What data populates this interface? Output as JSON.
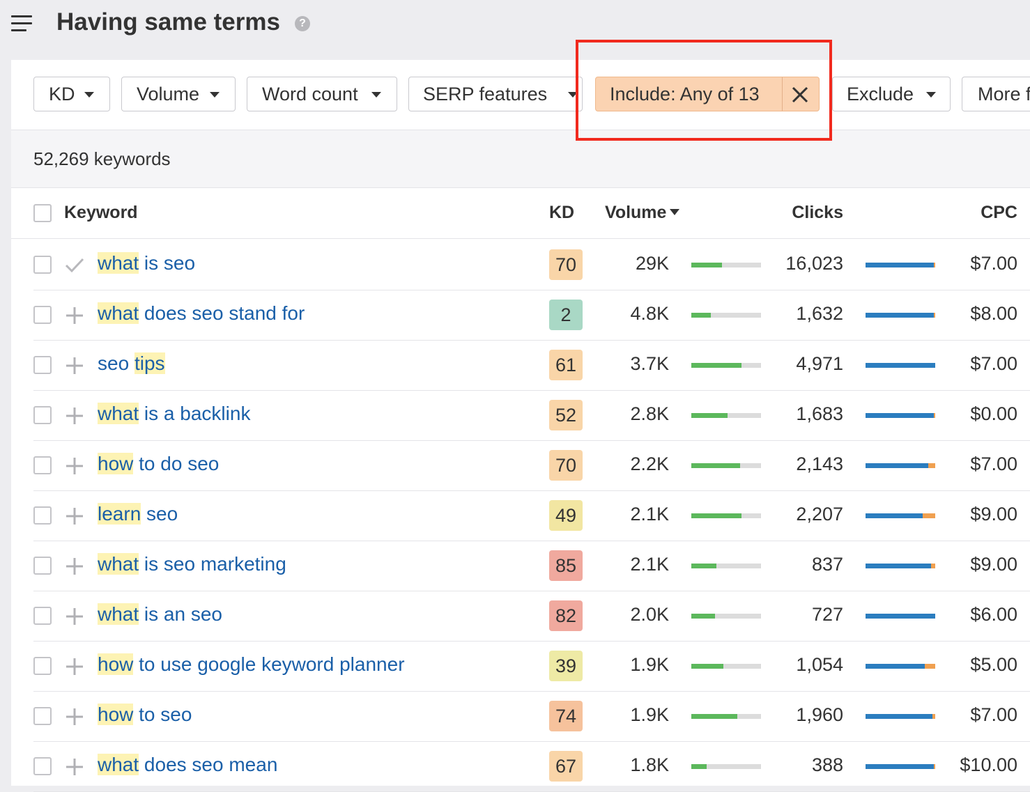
{
  "header": {
    "title": "Having same terms",
    "help_icon": "?"
  },
  "filters": {
    "kd": "KD",
    "volume": "Volume",
    "word_count": "Word count",
    "serp_features": "SERP features",
    "include": "Include: Any of 13",
    "exclude": "Exclude",
    "more": "More f"
  },
  "summary": {
    "count": "52,269 keywords"
  },
  "table": {
    "columns": {
      "keyword": "Keyword",
      "kd": "KD",
      "volume": "Volume",
      "clicks": "Clicks",
      "cpc": "CPC"
    },
    "rows": [
      {
        "hl": "what",
        "rest": " is seo",
        "kd": "70",
        "kd_color": "#f9d5a8",
        "volume": "29K",
        "volume_fill": 0.44,
        "clicks": "16,023",
        "clicks_blue": 0.98,
        "cpc": "$7.00",
        "mark": "check"
      },
      {
        "hl": "what",
        "rest": " does seo stand for",
        "kd": "2",
        "kd_color": "#a9d8c5",
        "volume": "4.8K",
        "volume_fill": 0.28,
        "clicks": "1,632",
        "clicks_blue": 0.98,
        "cpc": "$8.00",
        "mark": "plus"
      },
      {
        "pre": "seo ",
        "hl": "tips",
        "rest": "",
        "kd": "61",
        "kd_color": "#f9d5a8",
        "volume": "3.7K",
        "volume_fill": 0.72,
        "clicks": "4,971",
        "clicks_blue": 1.0,
        "cpc": "$7.00",
        "mark": "plus"
      },
      {
        "hl": "what",
        "rest": " is a backlink",
        "kd": "52",
        "kd_color": "#f9d5a8",
        "volume": "2.8K",
        "volume_fill": 0.52,
        "clicks": "1,683",
        "clicks_blue": 0.98,
        "cpc": "$0.00",
        "mark": "plus"
      },
      {
        "hl": "how",
        "rest": " to do seo",
        "kd": "70",
        "kd_color": "#f9d5a8",
        "volume": "2.2K",
        "volume_fill": 0.7,
        "clicks": "2,143",
        "clicks_blue": 0.9,
        "cpc": "$7.00",
        "mark": "plus"
      },
      {
        "hl": "learn",
        "rest": " seo",
        "kd": "49",
        "kd_color": "#f2e6a2",
        "volume": "2.1K",
        "volume_fill": 0.72,
        "clicks": "2,207",
        "clicks_blue": 0.82,
        "cpc": "$9.00",
        "mark": "plus"
      },
      {
        "hl": "what",
        "rest": " is seo marketing",
        "kd": "85",
        "kd_color": "#f0a99e",
        "volume": "2.1K",
        "volume_fill": 0.36,
        "clicks": "837",
        "clicks_blue": 0.94,
        "cpc": "$9.00",
        "mark": "plus"
      },
      {
        "hl": "what",
        "rest": " is an seo",
        "kd": "82",
        "kd_color": "#f0a99e",
        "volume": "2.0K",
        "volume_fill": 0.34,
        "clicks": "727",
        "clicks_blue": 1.0,
        "cpc": "$6.00",
        "mark": "plus"
      },
      {
        "hl": "how",
        "rest": " to use google keyword planner",
        "kd": "39",
        "kd_color": "#eeeaa5",
        "volume": "1.9K",
        "volume_fill": 0.46,
        "clicks": "1,054",
        "clicks_blue": 0.85,
        "cpc": "$5.00",
        "mark": "plus"
      },
      {
        "hl": "how",
        "rest": " to seo",
        "kd": "74",
        "kd_color": "#f6c29c",
        "volume": "1.9K",
        "volume_fill": 0.66,
        "clicks": "1,960",
        "clicks_blue": 0.96,
        "cpc": "$7.00",
        "mark": "plus"
      },
      {
        "hl": "what",
        "rest": " does seo mean",
        "kd": "67",
        "kd_color": "#f9d5a8",
        "volume": "1.8K",
        "volume_fill": 0.22,
        "clicks": "388",
        "clicks_blue": 0.98,
        "cpc": "$10.00",
        "mark": "plus"
      }
    ]
  },
  "colors": {
    "accent_link": "#1a5fa8",
    "highlight": "#fdf3b4",
    "volume_bar": "#5cb85c",
    "clicks_bar": "#2b7dbf",
    "clicks_bar_alt": "#f0a050",
    "callout_border": "#f12a1e",
    "include_filter_bg": "#fbd3b2"
  }
}
